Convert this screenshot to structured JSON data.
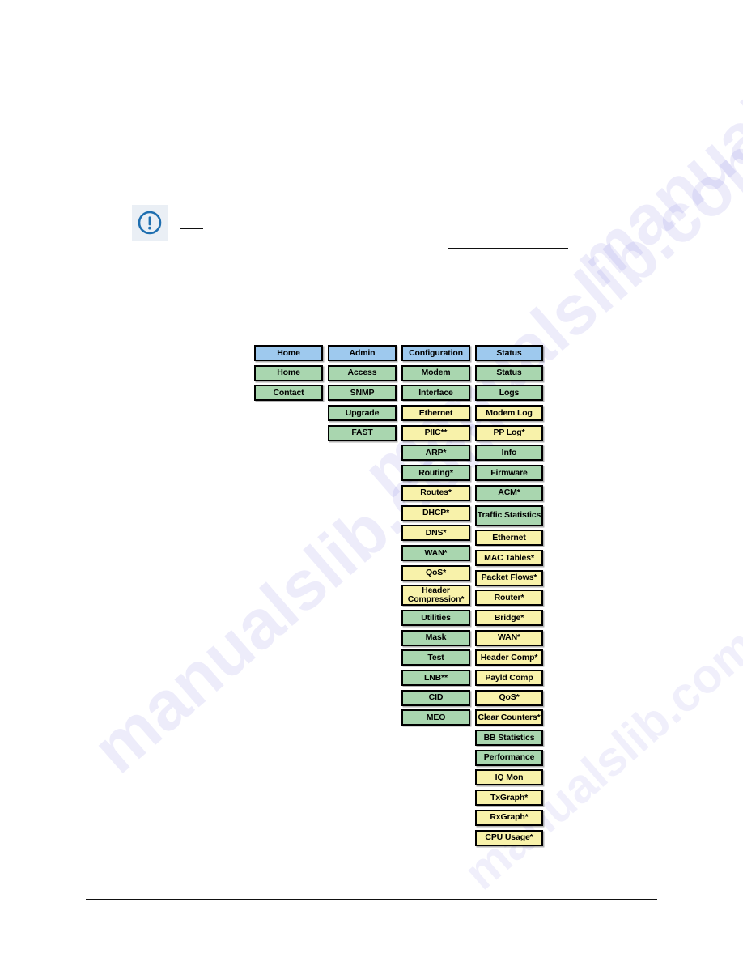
{
  "page": {
    "background_color": "#ffffff",
    "watermark_text": "manualslib.com",
    "watermark_color": "#3a2fd0"
  },
  "note": {
    "icon": "exclamation-circle-icon",
    "icon_color": "#1f6fb0",
    "icon_background": "#eaeff5"
  },
  "colors": {
    "blue": "#9ec9ee",
    "green": "#a9d6af",
    "yellow": "#f8f2aa",
    "border": "#000000"
  },
  "menu_map": {
    "columns": [
      {
        "id": "home",
        "header": {
          "label": "Home",
          "color": "blue"
        },
        "items": [
          {
            "label": "Home",
            "color": "green"
          },
          {
            "label": "Contact",
            "color": "green"
          }
        ]
      },
      {
        "id": "admin",
        "header": {
          "label": "Admin",
          "color": "blue"
        },
        "items": [
          {
            "label": "Access",
            "color": "green"
          },
          {
            "label": "SNMP",
            "color": "green"
          },
          {
            "label": "Upgrade",
            "color": "green"
          },
          {
            "label": "FAST",
            "color": "green"
          }
        ]
      },
      {
        "id": "configuration",
        "header": {
          "label": "Configuration",
          "color": "blue"
        },
        "items": [
          {
            "label": "Modem",
            "color": "green"
          },
          {
            "label": "Interface",
            "color": "green"
          },
          {
            "label": "Ethernet",
            "color": "yellow"
          },
          {
            "label": "PIIC**",
            "color": "yellow"
          },
          {
            "label": "ARP*",
            "color": "green"
          },
          {
            "label": "Routing*",
            "color": "green"
          },
          {
            "label": "Routes*",
            "color": "yellow"
          },
          {
            "label": "DHCP*",
            "color": "yellow"
          },
          {
            "label": "DNS*",
            "color": "yellow"
          },
          {
            "label": "WAN*",
            "color": "green"
          },
          {
            "label": "QoS*",
            "color": "yellow"
          },
          {
            "label": "Header Compression*",
            "color": "yellow",
            "tall": true
          },
          {
            "label": "Utilities",
            "color": "green"
          },
          {
            "label": "Mask",
            "color": "green"
          },
          {
            "label": "Test",
            "color": "green"
          },
          {
            "label": "LNB**",
            "color": "green"
          },
          {
            "label": "CID",
            "color": "green"
          },
          {
            "label": "MEO",
            "color": "green"
          }
        ]
      },
      {
        "id": "status",
        "header": {
          "label": "Status",
          "color": "blue"
        },
        "items": [
          {
            "label": "Status",
            "color": "green"
          },
          {
            "label": "Logs",
            "color": "green"
          },
          {
            "label": "Modem Log",
            "color": "yellow"
          },
          {
            "label": "PP Log*",
            "color": "yellow"
          },
          {
            "label": "Info",
            "color": "green"
          },
          {
            "label": "Firmware",
            "color": "green"
          },
          {
            "label": "ACM*",
            "color": "green"
          },
          {
            "label": "Traffic Statistics",
            "color": "green",
            "tall": true
          },
          {
            "label": "Ethernet",
            "color": "yellow"
          },
          {
            "label": "MAC Tables*",
            "color": "yellow"
          },
          {
            "label": "Packet Flows*",
            "color": "yellow"
          },
          {
            "label": "Router*",
            "color": "yellow"
          },
          {
            "label": "Bridge*",
            "color": "yellow"
          },
          {
            "label": "WAN*",
            "color": "yellow"
          },
          {
            "label": "Header Comp*",
            "color": "yellow"
          },
          {
            "label": "Payld Comp",
            "color": "yellow"
          },
          {
            "label": "QoS*",
            "color": "yellow"
          },
          {
            "label": "Clear Counters*",
            "color": "yellow"
          },
          {
            "label": "BB Statistics",
            "color": "green"
          },
          {
            "label": "Performance",
            "color": "green"
          },
          {
            "label": "IQ Mon",
            "color": "yellow"
          },
          {
            "label": "TxGraph*",
            "color": "yellow"
          },
          {
            "label": "RxGraph*",
            "color": "yellow"
          },
          {
            "label": "CPU Usage*",
            "color": "yellow"
          }
        ]
      }
    ]
  }
}
